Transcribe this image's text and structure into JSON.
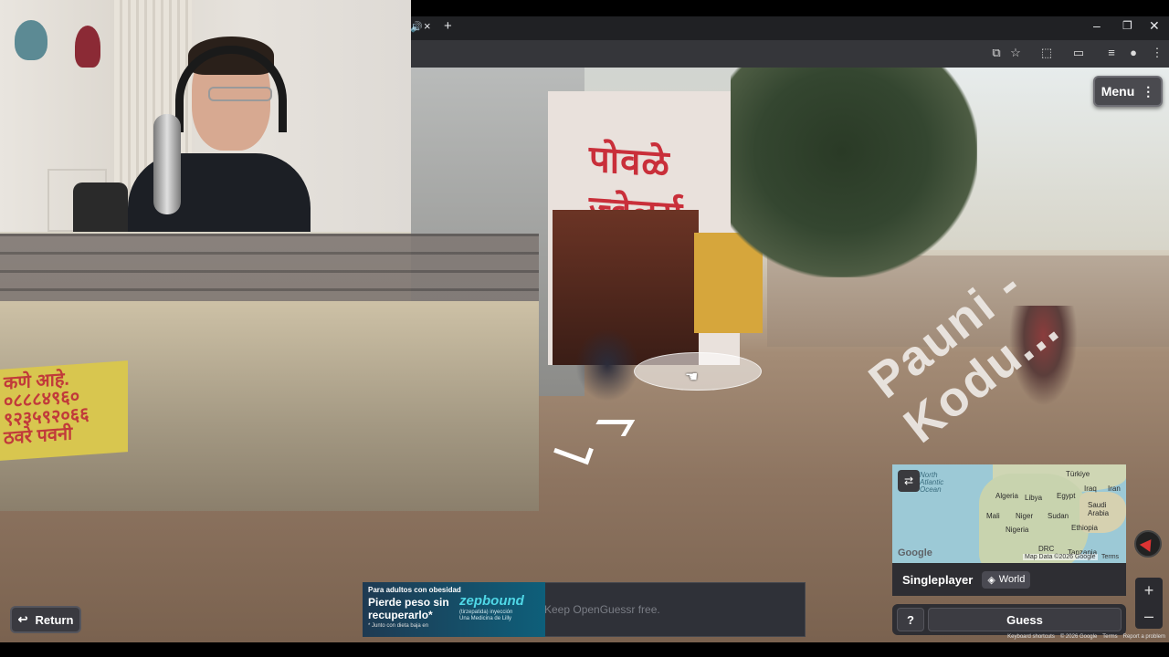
{
  "browser": {
    "tab_audio_icon": "speaker-icon",
    "tab_close": "×",
    "new_tab": "+",
    "window": {
      "minimize": "–",
      "maximize": "❐",
      "close": "✕"
    },
    "toolbar_icons": [
      "translate-icon",
      "star-icon",
      "extensions-icon",
      "cast-icon",
      "media-icon",
      "profile-icon",
      "more-icon"
    ]
  },
  "game": {
    "menu_label": "Menu",
    "menu_icon": "⋮",
    "minimap": {
      "labels": [
        "North Atlantic Ocean",
        "Algeria",
        "Libya",
        "Egypt",
        "Saudi Arabia",
        "Mali",
        "Niger",
        "Sudan",
        "Nigeria",
        "Ethiopia",
        "DRC",
        "Tanzania",
        "Türkiye",
        "Iraq",
        "Iran"
      ],
      "google_logo": "Google",
      "attribution": "Map Data ©2026 Google",
      "terms": "Terms"
    },
    "mode_label": "Singleplayer",
    "map_name": "World",
    "help_label": "?",
    "guess_label": "Guess",
    "return_label": "Return",
    "zoom_in": "+",
    "zoom_out": "–"
  },
  "scene": {
    "shop_sign": "पोवळे ज्वेलर्स",
    "wall_sign_lines": [
      "कणे आहे.",
      "०८८८४९६०",
      "९२३५९२०६६",
      "ठवरे पवनी"
    ],
    "road_text": "Pauni - Kodu..."
  },
  "ad": {
    "small_text": "Para adultos con obesidad",
    "headline": "Pierde peso sin recuperarlo*",
    "footnote": "* Junto con dieta baja en",
    "brand": "zepbound",
    "brand_sub": "(tirzepatida) inyección",
    "brand_maker": "Una Medicina de Lilly",
    "overlay_text": "Keep OpenGuessr free."
  },
  "footer": {
    "shortcuts": "Keyboard shortcuts",
    "copyright": "© 2026 Google",
    "terms": "Terms",
    "report": "Report a problem"
  },
  "colors": {
    "panel_bg": "#2e2e33",
    "button_bg": "#3c3c42",
    "shop_sign_red": "#c92f3a",
    "map_water": "#9cc9d6",
    "tab_bar": "#202124"
  }
}
